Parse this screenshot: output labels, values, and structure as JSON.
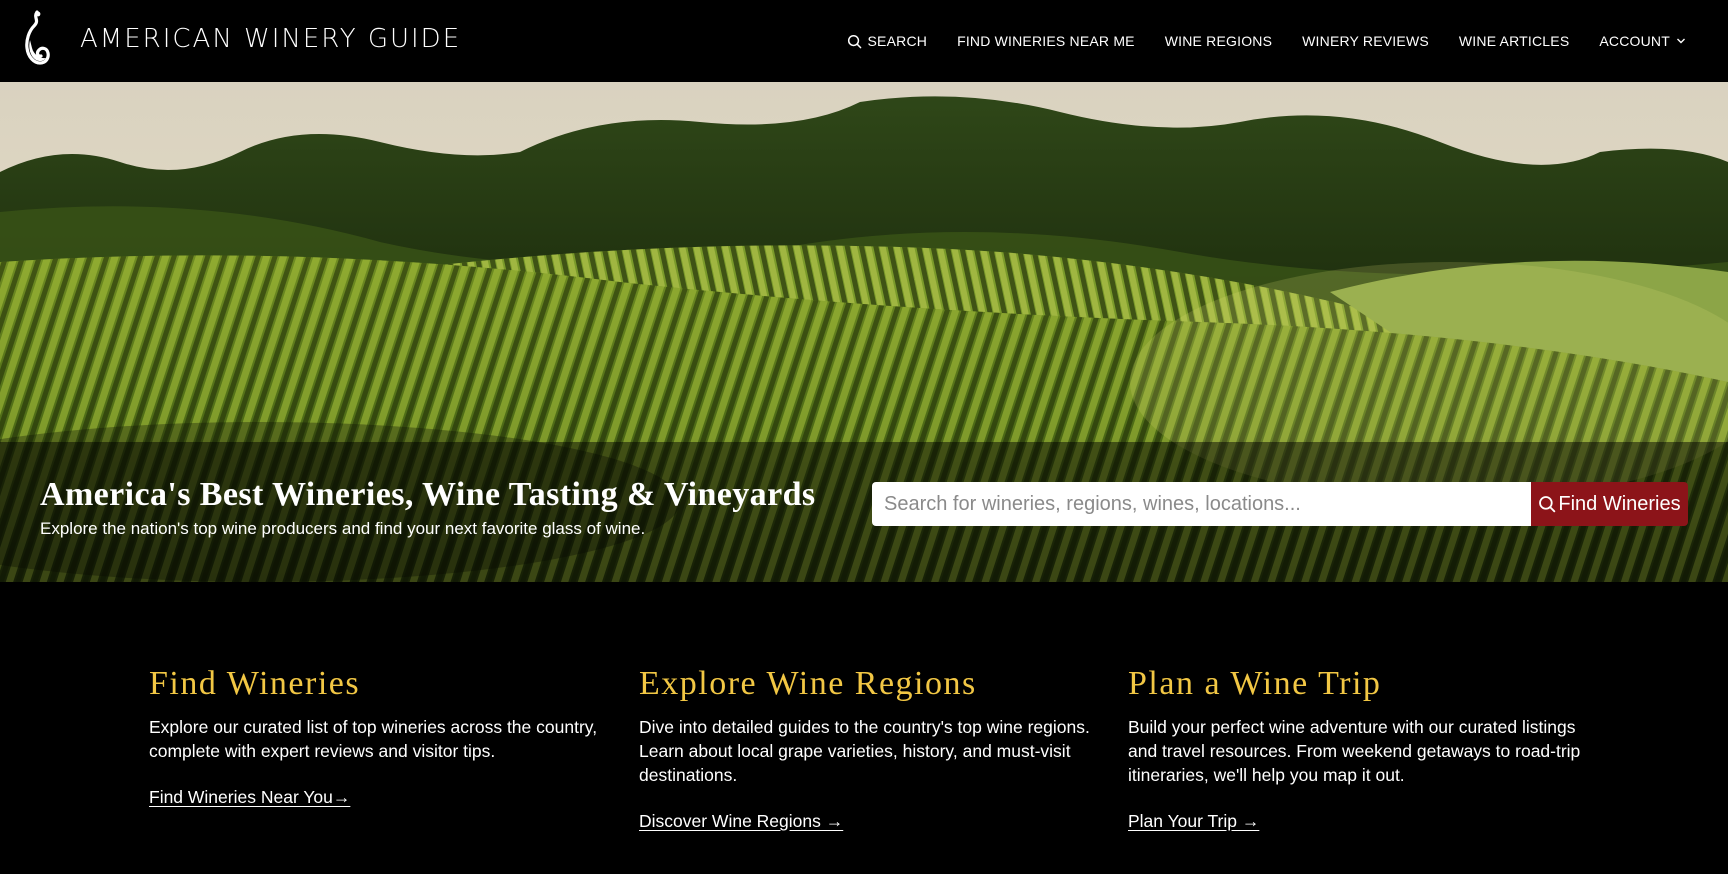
{
  "brand": {
    "name": "AMERICAN WINERY GUIDE",
    "logo_icon": "wine-glass-swirl-icon"
  },
  "nav": {
    "search": "SEARCH",
    "find_near_me": "FIND WINERIES NEAR ME",
    "regions": "WINE REGIONS",
    "reviews": "WINERY REVIEWS",
    "articles": "WINE ARTICLES",
    "account": "ACCOUNT"
  },
  "hero": {
    "title": "America's Best Wineries, Wine Tasting & Vineyards",
    "subtitle": "Explore the nation's top wine producers and find your next favorite glass of wine.",
    "search_placeholder": "Search for wineries, regions, wines, locations...",
    "search_button": "Find Wineries"
  },
  "features": [
    {
      "title": "Find Wineries",
      "body": "Explore our curated list of top wineries across the country, complete with expert reviews and visitor tips.",
      "link": "Find Wineries Near You→"
    },
    {
      "title": "Explore Wine Regions",
      "body": "Dive into detailed guides to the country's top wine regions. Learn about local grape varieties, history, and must-visit destinations.",
      "link": "Discover Wine Regions →"
    },
    {
      "title": "Plan a Wine Trip",
      "body": "Build your perfect wine adventure with our curated listings and travel resources. From weekend getaways to road-trip itineraries, we'll help you map it out.",
      "link": "Plan Your Trip →"
    }
  ],
  "colors": {
    "accent_gold": "#f2c744",
    "button_red": "#8c1419",
    "background": "#000000"
  }
}
